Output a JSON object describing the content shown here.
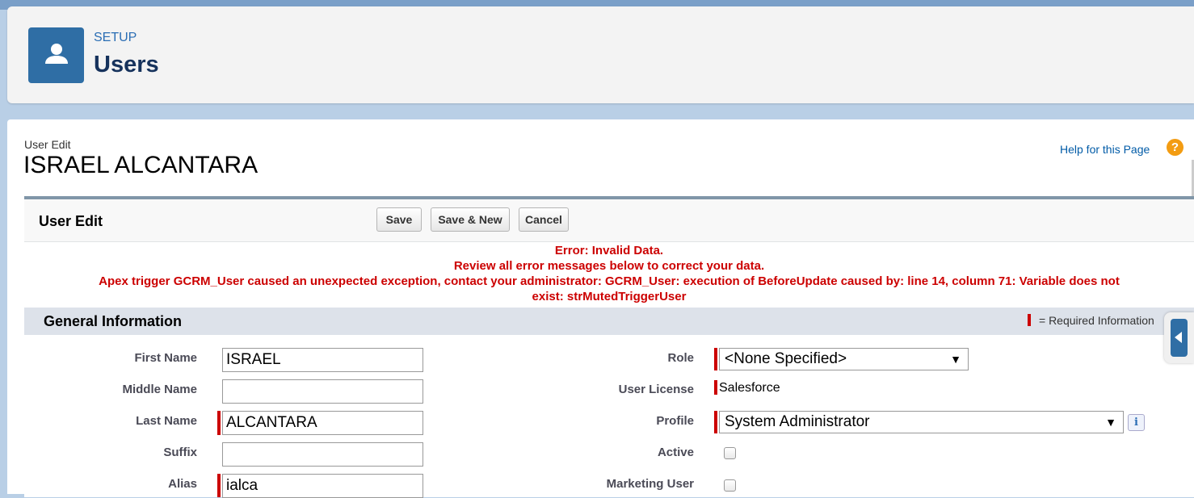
{
  "header": {
    "setup_label": "SETUP",
    "title": "Users",
    "icon": "user-icon"
  },
  "page": {
    "subtitle": "User Edit",
    "heading": "ISRAEL ALCANTARA",
    "help_link": "Help for this Page",
    "help_icon_glyph": "?"
  },
  "panel": {
    "title": "User Edit",
    "buttons": {
      "save": "Save",
      "save_new": "Save & New",
      "cancel": "Cancel"
    },
    "errors": {
      "line1": "Error: Invalid Data.",
      "line2": "Review all error messages below to correct your data.",
      "line3": "Apex trigger GCRM_User caused an unexpected exception, contact your administrator: GCRM_User: execution of BeforeUpdate caused by: line 14, column 71: Variable does not",
      "line4": "exist: strMutedTriggerUser"
    }
  },
  "section": {
    "title": "General Information",
    "required_legend": "= Required Information"
  },
  "fields": {
    "first_name": {
      "label": "First Name",
      "value": "ISRAEL"
    },
    "middle_name": {
      "label": "Middle Name",
      "value": ""
    },
    "last_name": {
      "label": "Last Name",
      "value": "ALCANTARA"
    },
    "suffix": {
      "label": "Suffix",
      "value": ""
    },
    "alias": {
      "label": "Alias",
      "value": "ialca"
    },
    "role": {
      "label": "Role",
      "value": "<None Specified>"
    },
    "user_license": {
      "label": "User License",
      "value": "Salesforce"
    },
    "profile": {
      "label": "Profile",
      "value": "System Administrator",
      "info_glyph": "i"
    },
    "active": {
      "label": "Active",
      "checked": false
    },
    "marketing_user": {
      "label": "Marketing User",
      "checked": false
    }
  },
  "colors": {
    "brand": "#2f6ea5",
    "error": "#cc0000",
    "required": "#cc0000"
  }
}
